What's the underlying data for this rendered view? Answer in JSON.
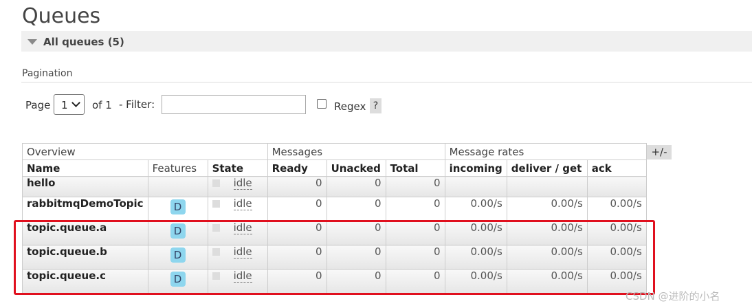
{
  "page": {
    "title": "Queues"
  },
  "section": {
    "label": "All queues (5)"
  },
  "pagination": {
    "title": "Pagination",
    "page_label": "Page",
    "page_value": "1",
    "of_label": "of 1",
    "filter_label": "- Filter:",
    "filter_value": "",
    "regex_label": "Regex",
    "help": "?"
  },
  "table": {
    "groups": [
      "Overview",
      "Messages",
      "Message rates"
    ],
    "columns": [
      "Name",
      "Features",
      "State",
      "Ready",
      "Unacked",
      "Total",
      "incoming",
      "deliver / get",
      "ack"
    ],
    "plus_minus": "+/-",
    "rows": [
      {
        "name": "hello",
        "feature": "",
        "state": "idle",
        "ready": "0",
        "unacked": "0",
        "total": "0",
        "incoming": "",
        "deliver_get": "",
        "ack": ""
      },
      {
        "name": "rabbitmqDemoTopic",
        "feature": "D",
        "state": "idle",
        "ready": "0",
        "unacked": "0",
        "total": "0",
        "incoming": "0.00/s",
        "deliver_get": "0.00/s",
        "ack": "0.00/s"
      },
      {
        "name": "topic.queue.a",
        "feature": "D",
        "state": "idle",
        "ready": "0",
        "unacked": "0",
        "total": "0",
        "incoming": "0.00/s",
        "deliver_get": "0.00/s",
        "ack": "0.00/s"
      },
      {
        "name": "topic.queue.b",
        "feature": "D",
        "state": "idle",
        "ready": "0",
        "unacked": "0",
        "total": "0",
        "incoming": "0.00/s",
        "deliver_get": "0.00/s",
        "ack": "0.00/s"
      },
      {
        "name": "topic.queue.c",
        "feature": "D",
        "state": "idle",
        "ready": "0",
        "unacked": "0",
        "total": "0",
        "incoming": "0.00/s",
        "deliver_get": "0.00/s",
        "ack": "0.00/s"
      }
    ]
  },
  "watermark": "CSDN @进阶的小名",
  "colors": {
    "highlight": "#e0101e",
    "feature_badge": "#8ed6ee"
  }
}
